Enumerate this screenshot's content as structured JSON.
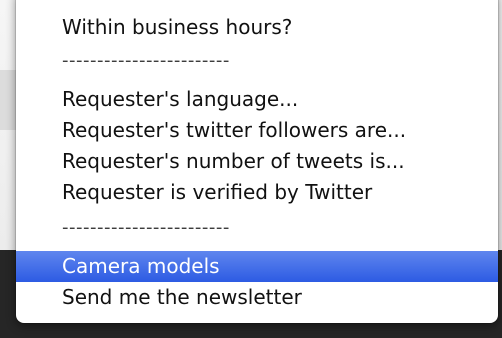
{
  "menu": {
    "items": [
      {
        "label": "Within business hours?"
      },
      {
        "label": "------------------------"
      },
      {
        "label": "Requester's language..."
      },
      {
        "label": "Requester's twitter followers are..."
      },
      {
        "label": "Requester's number of tweets is..."
      },
      {
        "label": "Requester is verified by Twitter"
      },
      {
        "label": "------------------------"
      },
      {
        "label": "Camera models",
        "highlighted": true
      },
      {
        "label": "Send me the newsletter"
      }
    ]
  },
  "colors": {
    "highlight": "#2d5be3",
    "menu_background": "#ffffff"
  }
}
